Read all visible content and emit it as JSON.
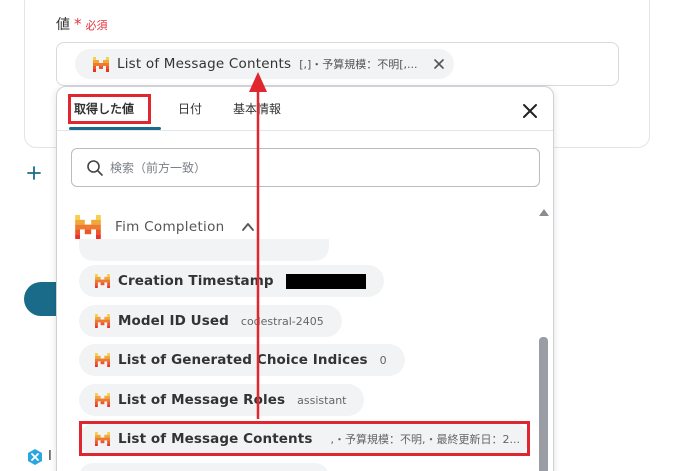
{
  "field": {
    "label": "値",
    "required_star": "*",
    "required_text": "必須"
  },
  "selected_chip": {
    "label": "List of Message Contents",
    "value_preview": "[,]・予算規模：不明[,..."
  },
  "popup": {
    "tabs": [
      {
        "label": "取得した値",
        "active": true
      },
      {
        "label": "日付",
        "active": false
      },
      {
        "label": "基本情報",
        "active": false
      }
    ],
    "search_placeholder": "検索（前方一致）",
    "section_title": "Fim Completion",
    "items": [
      {
        "label": "Creation Timestamp",
        "value": "",
        "redacted": true
      },
      {
        "label": "Model ID Used",
        "value": "codestral-2405"
      },
      {
        "label": "List of Generated Choice Indices",
        "value": "0"
      },
      {
        "label": "List of Message Roles",
        "value": "assistant"
      },
      {
        "label": "List of Message Contents",
        "value": ",・予算規模：不明,・最終更新日：2..."
      }
    ]
  },
  "colors": {
    "accent": "#1a6b8a",
    "highlight": "#e0262f",
    "required": "#e2343f",
    "mistral_colors": [
      "#f7d046",
      "#f2a73b",
      "#ee792f",
      "#eb5829",
      "#ea3326",
      "#000000"
    ]
  },
  "bottom_badge_char": "I"
}
